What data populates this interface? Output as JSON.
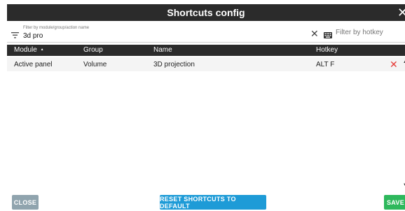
{
  "window": {
    "title": "Shortcuts config",
    "close_glyph": "✕"
  },
  "filter": {
    "caption": "Filter by module/group/action name",
    "value": "3d pro",
    "clear_glyph": "✕",
    "hotkey_placeholder": "Filter by hotkey"
  },
  "table": {
    "headers": {
      "module": "Module",
      "sort_indicator": "▲",
      "group": "Group",
      "name": "Name",
      "hotkey": "Hotkey"
    },
    "rows": [
      {
        "module": "Active panel",
        "group": "Volume",
        "name": "3D projection",
        "hotkey": "ALT F",
        "delete_glyph": "✕"
      }
    ]
  },
  "scroll": {
    "up_glyph": "▲",
    "down_glyph": "▼"
  },
  "footer": {
    "close_label": "CLOSE",
    "reset_label": "RESET SHORTCUTS TO DEFAULT",
    "save_label": "SAVE"
  },
  "colors": {
    "header_bg": "#2b2b2b",
    "delete": "#e53935",
    "close_button": "#90a4ae",
    "reset_button": "#1e9bd7",
    "save_button": "#2eb85c"
  },
  "icons": {
    "filter": "filter-icon",
    "keyboard": "keyboard-icon",
    "clear": "close-icon",
    "delete": "delete-icon"
  }
}
